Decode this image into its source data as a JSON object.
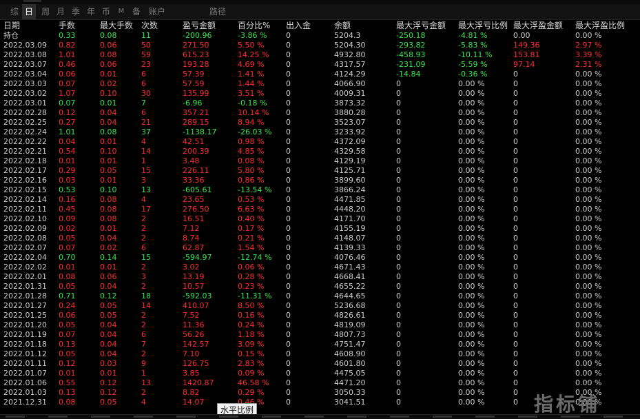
{
  "toolbar": {
    "tabs": [
      "综",
      "日",
      "周",
      "月",
      "季",
      "年",
      "币",
      "M",
      "备",
      "账户",
      "路径"
    ],
    "active_index": 1
  },
  "table": {
    "headers": [
      "日期",
      "手数",
      "最大手数",
      "次数",
      "盈亏金额",
      "百分比%",
      "出入金",
      "余额",
      "最大浮亏金额",
      "最大浮亏比例",
      "最大浮盈金额",
      "最大浮盈比例"
    ],
    "rows": [
      [
        "持仓",
        "0.33",
        "0.08",
        "11",
        "-200.96",
        "-3.86 %",
        "0",
        "5204.3",
        "-250.18",
        "-4.81 %",
        "0.00",
        "0.00 %"
      ],
      [
        "2022.03.09",
        "0.82",
        "0.06",
        "50",
        "271.50",
        "5.50 %",
        "0",
        "5204.30",
        "-293.82",
        "-5.83 %",
        "149.36",
        "2.97 %"
      ],
      [
        "2022.03.08",
        "1.01",
        "0.08",
        "59",
        "615.23",
        "14.25 %",
        "0",
        "4932.80",
        "-458.93",
        "-10.11 %",
        "153.81",
        "3.39 %"
      ],
      [
        "2022.03.07",
        "0.46",
        "0.06",
        "23",
        "193.28",
        "4.69 %",
        "0",
        "4317.57",
        "-231.09",
        "-5.59 %",
        "97.14",
        "2.31 %"
      ],
      [
        "2022.03.04",
        "0.06",
        "0.01",
        "6",
        "57.39",
        "1.41 %",
        "0",
        "4124.29",
        "-14.84",
        "-0.36 %",
        "0",
        "0.00 %"
      ],
      [
        "2022.03.03",
        "0.07",
        "0.02",
        "6",
        "57.59",
        "1.44 %",
        "0",
        "4066.90",
        "0",
        "0.00 %",
        "0",
        "0.00 %"
      ],
      [
        "2022.03.02",
        "1.07",
        "0.10",
        "30",
        "135.99",
        "3.51 %",
        "0",
        "4009.31",
        "0",
        "0.00 %",
        "0",
        "0.00 %"
      ],
      [
        "2022.03.01",
        "0.07",
        "0.01",
        "7",
        "-6.96",
        "-0.18 %",
        "0",
        "3873.32",
        "0",
        "0.00 %",
        "0",
        "0.00 %"
      ],
      [
        "2022.02.28",
        "0.12",
        "0.04",
        "6",
        "357.21",
        "10.14 %",
        "0",
        "3880.28",
        "0",
        "0.00 %",
        "0",
        "0.00 %"
      ],
      [
        "2022.02.25",
        "0.27",
        "0.04",
        "21",
        "289.15",
        "8.94 %",
        "0",
        "3523.07",
        "0",
        "0.00 %",
        "0",
        "0.00 %"
      ],
      [
        "2022.02.24",
        "1.01",
        "0.08",
        "37",
        "-1138.17",
        "-26.03 %",
        "0",
        "3233.92",
        "0",
        "0.00 %",
        "0",
        "0.00 %"
      ],
      [
        "2022.02.22",
        "0.04",
        "0.01",
        "4",
        "42.51",
        "0.98 %",
        "0",
        "4372.09",
        "0",
        "0.00 %",
        "0",
        "0.00 %"
      ],
      [
        "2022.02.21",
        "0.54",
        "0.10",
        "14",
        "200.39",
        "4.85 %",
        "0",
        "4329.58",
        "0",
        "0.00 %",
        "0",
        "0.00 %"
      ],
      [
        "2022.02.18",
        "0.01",
        "0.01",
        "1",
        "3.48",
        "0.08 %",
        "0",
        "4129.19",
        "0",
        "0.00 %",
        "0",
        "0.00 %"
      ],
      [
        "2022.02.17",
        "0.29",
        "0.05",
        "15",
        "226.11",
        "5.80 %",
        "0",
        "4125.71",
        "0",
        "0.00 %",
        "0",
        "0.00 %"
      ],
      [
        "2022.02.16",
        "0.03",
        "0.01",
        "3",
        "33.36",
        "0.86 %",
        "0",
        "3899.60",
        "0",
        "0.00 %",
        "0",
        "0.00 %"
      ],
      [
        "2022.02.15",
        "0.53",
        "0.10",
        "13",
        "-605.61",
        "-13.54 %",
        "0",
        "3866.24",
        "0",
        "0.00 %",
        "0",
        "0.00 %"
      ],
      [
        "2022.02.14",
        "0.16",
        "0.08",
        "4",
        "23.65",
        "0.53 %",
        "0",
        "4471.85",
        "0",
        "0.00 %",
        "0",
        "0.00 %"
      ],
      [
        "2022.02.11",
        "0.45",
        "0.08",
        "17",
        "276.50",
        "6.63 %",
        "0",
        "4448.20",
        "0",
        "0.00 %",
        "0",
        "0.00 %"
      ],
      [
        "2022.02.10",
        "0.09",
        "0.08",
        "2",
        "16.51",
        "0.40 %",
        "0",
        "4171.70",
        "0",
        "0.00 %",
        "0",
        "0.00 %"
      ],
      [
        "2022.02.09",
        "0.02",
        "0.01",
        "2",
        "7.12",
        "0.17 %",
        "0",
        "4155.19",
        "0",
        "0.00 %",
        "0",
        "0.00 %"
      ],
      [
        "2022.02.08",
        "0.05",
        "0.04",
        "2",
        "8.74",
        "0.21 %",
        "0",
        "4148.07",
        "0",
        "0.00 %",
        "0",
        "0.00 %"
      ],
      [
        "2022.02.07",
        "0.07",
        "0.02",
        "6",
        "62.87",
        "1.54 %",
        "0",
        "4139.33",
        "0",
        "0.00 %",
        "0",
        "0.00 %"
      ],
      [
        "2022.02.04",
        "0.70",
        "0.14",
        "15",
        "-594.97",
        "-12.74 %",
        "0",
        "4076.46",
        "0",
        "0.00 %",
        "0",
        "0.00 %"
      ],
      [
        "2022.02.02",
        "0.01",
        "0.01",
        "2",
        "3.02",
        "0.06 %",
        "0",
        "4671.43",
        "0",
        "0.00 %",
        "0",
        "0.00 %"
      ],
      [
        "2022.02.01",
        "0.08",
        "0.06",
        "3",
        "13.19",
        "0.28 %",
        "0",
        "4668.41",
        "0",
        "0.00 %",
        "0",
        "0.00 %"
      ],
      [
        "2022.01.31",
        "0.05",
        "0.04",
        "2",
        "10.57",
        "0.23 %",
        "0",
        "4655.22",
        "0",
        "0.00 %",
        "0",
        "0.00 %"
      ],
      [
        "2022.01.28",
        "0.71",
        "0.12",
        "18",
        "-592.03",
        "-11.31 %",
        "0",
        "4644.65",
        "0",
        "0.00 %",
        "0",
        "0.00 %"
      ],
      [
        "2022.01.27",
        "0.24",
        "0.05",
        "14",
        "410.07",
        "8.50 %",
        "0",
        "5236.68",
        "0",
        "0.00 %",
        "0",
        "0.00 %"
      ],
      [
        "2022.01.25",
        "0.06",
        "0.05",
        "2",
        "7.52",
        "0.16 %",
        "0",
        "4826.61",
        "0",
        "0.00 %",
        "0",
        "0.00 %"
      ],
      [
        "2022.01.20",
        "0.05",
        "0.04",
        "2",
        "11.36",
        "0.24 %",
        "0",
        "4819.09",
        "0",
        "0.00 %",
        "0",
        "0.00 %"
      ],
      [
        "2022.01.19",
        "0.07",
        "0.04",
        "6",
        "56.26",
        "1.18 %",
        "0",
        "4807.73",
        "0",
        "0.00 %",
        "0",
        "0.00 %"
      ],
      [
        "2022.01.18",
        "0.13",
        "0.04",
        "7",
        "142.57",
        "3.09 %",
        "0",
        "4751.47",
        "0",
        "0.00 %",
        "0",
        "0.00 %"
      ],
      [
        "2022.01.12",
        "0.05",
        "0.04",
        "2",
        "7.10",
        "0.15 %",
        "0",
        "4608.90",
        "0",
        "0.00 %",
        "0",
        "0.00 %"
      ],
      [
        "2022.01.11",
        "0.12",
        "0.03",
        "9",
        "126.75",
        "2.83 %",
        "0",
        "4601.80",
        "0",
        "0.00 %",
        "0",
        "0.00 %"
      ],
      [
        "2022.01.07",
        "0.01",
        "0.01",
        "1",
        "3.85",
        "0.09 %",
        "0",
        "4475.05",
        "0",
        "0.00 %",
        "0",
        "0.00 %"
      ],
      [
        "2022.01.06",
        "0.55",
        "0.12",
        "13",
        "1420.87",
        "46.58 %",
        "0",
        "4471.20",
        "0",
        "0.00 %",
        "0",
        "0.00 %"
      ],
      [
        "2022.01.03",
        "0.13",
        "0.12",
        "2",
        "8.82",
        "0.29 %",
        "0",
        "3050.33",
        "0",
        "0.00 %",
        "0",
        "0.00 %"
      ],
      [
        "2021.12.31",
        "0.08",
        "0.05",
        "4",
        "14.07",
        "0.46 %",
        "0",
        "3041.51",
        "0",
        "0.00 %",
        "0",
        "0.00 %"
      ]
    ]
  },
  "tooltip": "水平比例",
  "watermark": "指标铺",
  "colors": {
    "profit": "#ff2d2d",
    "loss": "#37e64b",
    "neutral": "#cfcfcf",
    "background": "#000000"
  }
}
